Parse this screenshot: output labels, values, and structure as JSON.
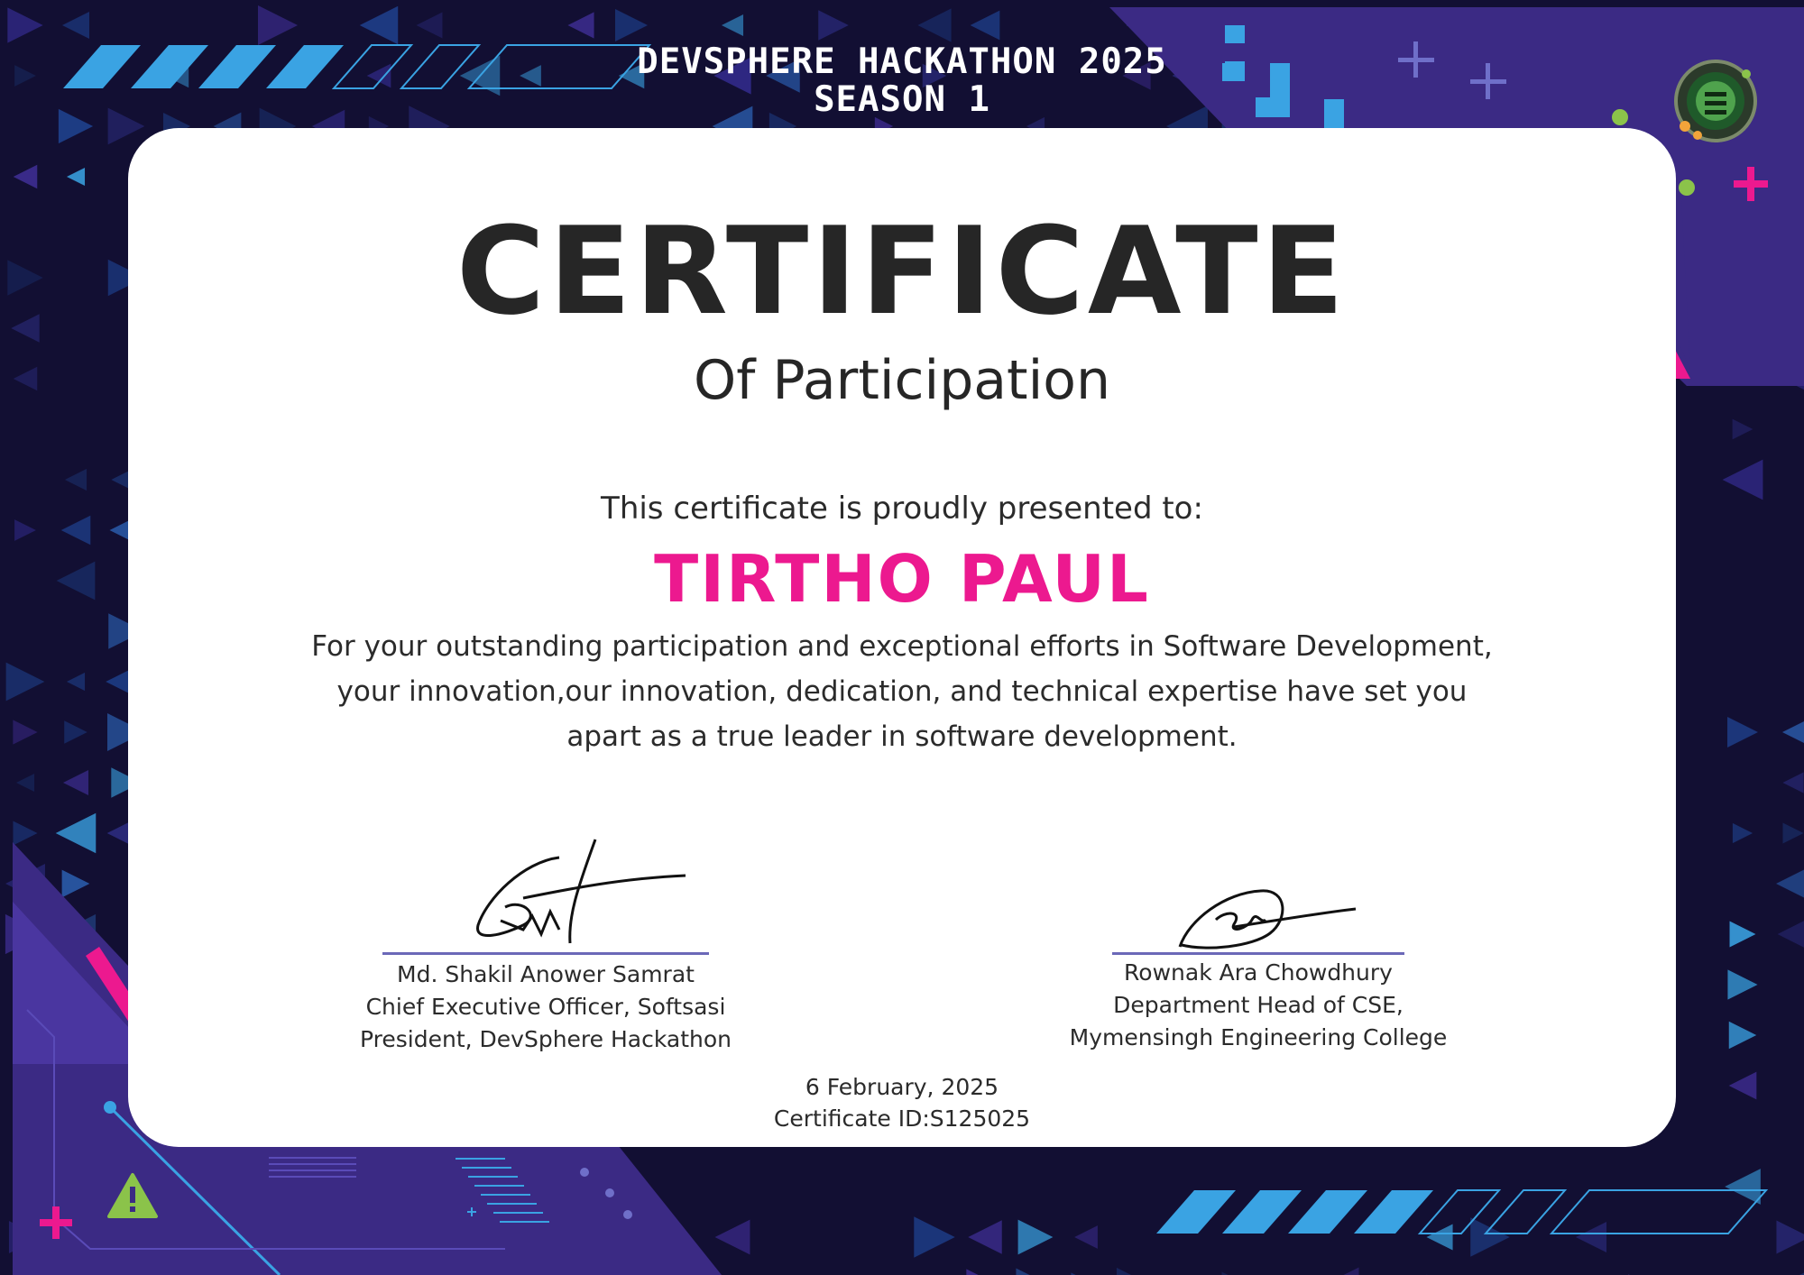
{
  "header": {
    "line1": "DEVSPHERE HACKATHON 2025",
    "line2": "SEASON 1"
  },
  "certificate": {
    "title": "CERTIFICATE",
    "subtitle": "Of Participation",
    "presented_to": "This certificate is proudly presented to:",
    "recipient": "TIRTHO PAUL",
    "body": [
      "For your outstanding participation and exceptional efforts in Software Development,",
      "your innovation,our innovation, dedication, and technical expertise have set you",
      "apart as a true leader in software development."
    ]
  },
  "signatories": [
    {
      "name": "Md. Shakil Anower Samrat",
      "role1": "Chief Executive Officer, Softsasi",
      "role2": "President, DevSphere Hackathon"
    },
    {
      "name": "Rownak Ara Chowdhury",
      "role1": "Department Head of CSE,",
      "role2": "Mymensingh Engineering College"
    }
  ],
  "footer": {
    "date": "6 February, 2025",
    "certificate_id": "Certificate ID:S125025"
  },
  "icons": {
    "logo": "devsphere-logo-icon",
    "warning": "warning-icon",
    "plus": "plus-icon"
  },
  "colors": {
    "background": "#120f33",
    "accent_pink": "#ec198f",
    "accent_blue": "#3aa3e3",
    "accent_purple": "#3f2a8a",
    "accent_green": "#8bc34a"
  }
}
